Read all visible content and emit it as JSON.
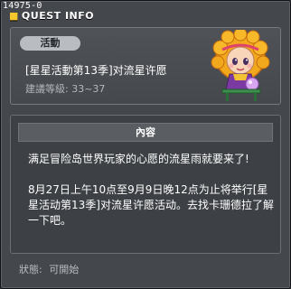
{
  "window": {
    "id": "14975-0",
    "title": "QUEST INFO"
  },
  "quest": {
    "category": "活動",
    "name": "[星星活動第13季]对流星许愿",
    "level_label": "建議等級:",
    "level_range": "33~37"
  },
  "info": {
    "header": "內容",
    "paragraphs": [
      "满足冒险岛世界玩家的心愿的流星雨就要来了!",
      "8月27日上午10点至9月9日晚12点为止将举行[星星活动第13季]对流星许愿活动。去找卡珊德拉了解一下吧。"
    ]
  },
  "status": {
    "label": "狀態:",
    "value": "可開始"
  },
  "colors": {
    "window_bg": "#44474c",
    "badge_bg": "#b9bcc1",
    "title_accent": "#f6c62d",
    "npc_hair": "#f2a81d"
  },
  "icons": {
    "npc": "npc-cassandra-portrait",
    "title_bullet": "title-bullet-icon"
  }
}
